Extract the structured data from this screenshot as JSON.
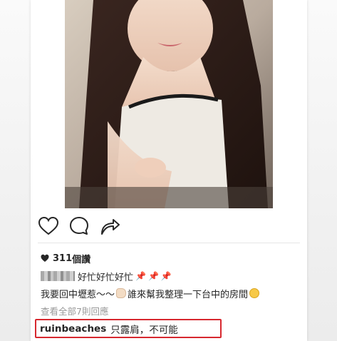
{
  "post": {
    "likes_count": "311",
    "likes_suffix": "個讚",
    "caption": {
      "line1_text": "好忙好忙好忙",
      "line2_before": "我要回中壢惹～～",
      "line2_after": "誰來幫我整理一下台中的房間"
    },
    "view_all_comments": "查看全部7則回應",
    "highlighted_comment": {
      "username": "ruinbeaches",
      "text": "只露肩，不可能"
    }
  },
  "icons": {
    "like": "heart-outline-icon",
    "comment": "comment-bubble-icon",
    "share": "share-arrow-icon",
    "likes": "heart-filled-icon",
    "pin": "pushpin-icon"
  },
  "colors": {
    "highlight_border": "#d7282f",
    "text_primary": "#262626",
    "text_secondary": "#999999",
    "pin": "#d23a3a"
  }
}
